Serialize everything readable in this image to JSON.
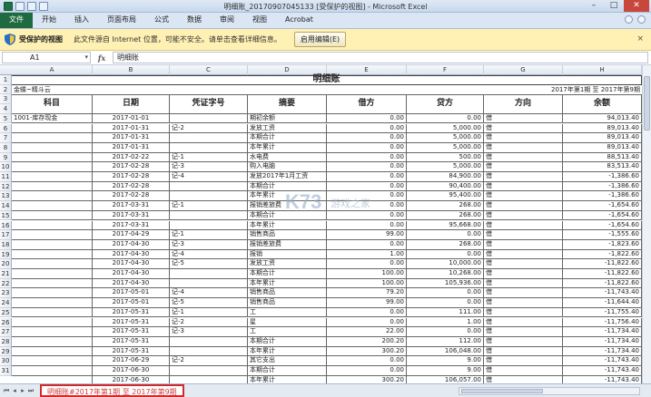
{
  "window": {
    "title": "明细账_20170907045133 [受保护的视图] - Microsoft Excel",
    "icons": [
      "excel-icon",
      "save-icon",
      "undo-icon",
      "redo-icon"
    ]
  },
  "ribbon": {
    "file": "文件",
    "tabs": [
      "开始",
      "插入",
      "页面布局",
      "公式",
      "数据",
      "审阅",
      "视图",
      "Acrobat"
    ]
  },
  "protected_view": {
    "title": "受保护的视图",
    "message": "此文件源自 Internet 位置，可能不安全。请单击查看详细信息。",
    "button": "启用编辑(E)",
    "close": "×"
  },
  "formula_bar": {
    "name_box": "A1",
    "fx": "fx",
    "value": "明细账"
  },
  "columns": [
    "A",
    "B",
    "C",
    "D",
    "E",
    "F",
    "G",
    "H"
  ],
  "sheet": {
    "title": "明细账",
    "company": "金蝶~精斗云",
    "period": "2017年第1期 至 2017年第9期",
    "headers": [
      "科目",
      "日期",
      "凭证字号",
      "摘要",
      "借方",
      "贷方",
      "方向",
      "余额"
    ],
    "rows": [
      [
        "1001-库存现金",
        "2017-01-01",
        "",
        "期初余额",
        "0.00",
        "0.00",
        "借",
        "94,013.40"
      ],
      [
        "",
        "2017-01-31",
        "记-2",
        "发放工资",
        "0.00",
        "5,000.00",
        "借",
        "89,013.40"
      ],
      [
        "",
        "2017-01-31",
        "",
        "本期合计",
        "0.00",
        "5,000.00",
        "借",
        "89,013.40"
      ],
      [
        "",
        "2017-01-31",
        "",
        "本年累计",
        "0.00",
        "5,000.00",
        "借",
        "89,013.40"
      ],
      [
        "",
        "2017-02-22",
        "记-1",
        "水电费",
        "0.00",
        "500.00",
        "借",
        "88,513.40"
      ],
      [
        "",
        "2017-02-28",
        "记-3",
        "购入电脑",
        "0.00",
        "5,000.00",
        "借",
        "83,513.40"
      ],
      [
        "",
        "2017-02-28",
        "记-4",
        "发放2017年1月工资",
        "0.00",
        "84,900.00",
        "借",
        "-1,386.60"
      ],
      [
        "",
        "2017-02-28",
        "",
        "本期合计",
        "0.00",
        "90,400.00",
        "借",
        "-1,386.60"
      ],
      [
        "",
        "2017-02-28",
        "",
        "本年累计",
        "0.00",
        "95,400.00",
        "借",
        "-1,386.60"
      ],
      [
        "",
        "2017-03-31",
        "记-1",
        "报销差旅费",
        "0.00",
        "268.00",
        "借",
        "-1,654.60"
      ],
      [
        "",
        "2017-03-31",
        "",
        "本期合计",
        "0.00",
        "268.00",
        "借",
        "-1,654.60"
      ],
      [
        "",
        "2017-03-31",
        "",
        "本年累计",
        "0.00",
        "95,668.00",
        "借",
        "-1,654.60"
      ],
      [
        "",
        "2017-04-29",
        "记-1",
        "销售商品",
        "99.00",
        "0.00",
        "借",
        "-1,555.60"
      ],
      [
        "",
        "2017-04-30",
        "记-3",
        "报销差旅费",
        "0.00",
        "268.00",
        "借",
        "-1,823.60"
      ],
      [
        "",
        "2017-04-30",
        "记-4",
        "报销",
        "1.00",
        "0.00",
        "借",
        "-1,822.60"
      ],
      [
        "",
        "2017-04-30",
        "记-5",
        "发放工资",
        "0.00",
        "10,000.00",
        "借",
        "-11,822.60"
      ],
      [
        "",
        "2017-04-30",
        "",
        "本期合计",
        "100.00",
        "10,268.00",
        "借",
        "-11,822.60"
      ],
      [
        "",
        "2017-04-30",
        "",
        "本年累计",
        "100.00",
        "105,936.00",
        "借",
        "-11,822.60"
      ],
      [
        "",
        "2017-05-01",
        "记-4",
        "销售商品",
        "79.20",
        "0.00",
        "借",
        "-11,743.40"
      ],
      [
        "",
        "2017-05-01",
        "记-5",
        "销售商品",
        "99.00",
        "0.00",
        "借",
        "-11,644.40"
      ],
      [
        "",
        "2017-05-31",
        "记-1",
        "工",
        "0.00",
        "111.00",
        "借",
        "-11,755.40"
      ],
      [
        "",
        "2017-05-31",
        "记-2",
        "星",
        "0.00",
        "1.00",
        "借",
        "-11,756.40"
      ],
      [
        "",
        "2017-05-31",
        "记-3",
        "工",
        "22.00",
        "0.00",
        "借",
        "-11,734.40"
      ],
      [
        "",
        "2017-05-31",
        "",
        "本期合计",
        "200.20",
        "112.00",
        "借",
        "-11,734.40"
      ],
      [
        "",
        "2017-05-31",
        "",
        "本年累计",
        "300.20",
        "106,048.00",
        "借",
        "-11,734.40"
      ],
      [
        "",
        "2017-06-29",
        "记-2",
        "其它支出",
        "0.00",
        "9.00",
        "借",
        "-11,743.40"
      ],
      [
        "",
        "2017-06-30",
        "",
        "本期合计",
        "0.00",
        "9.00",
        "借",
        "-11,743.40"
      ],
      [
        "",
        "2017-06-30",
        "",
        "本年累计",
        "300.20",
        "106,057.00",
        "借",
        "-11,743.40"
      ]
    ]
  },
  "sheet_tab": "明细账#2017年第1期 至 2017年第9期",
  "watermark": "K73 游戏之家"
}
